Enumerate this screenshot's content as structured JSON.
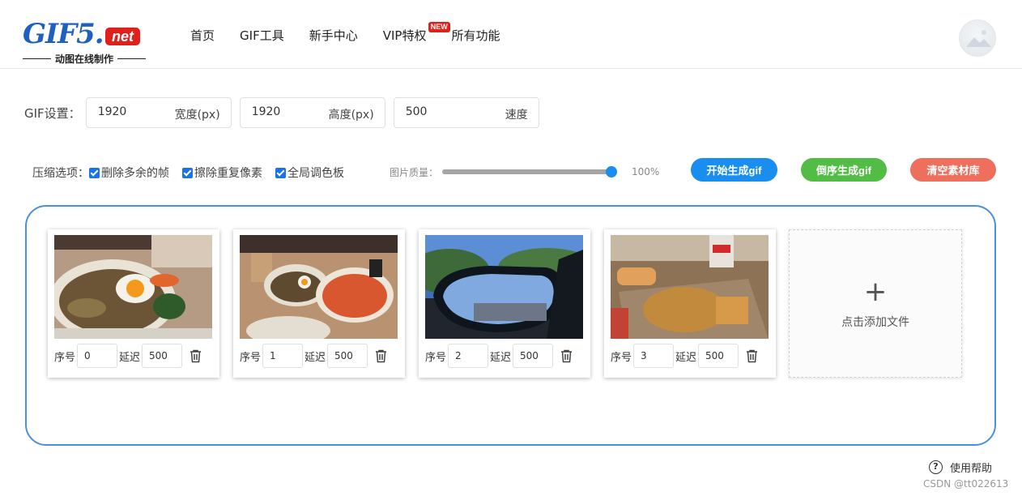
{
  "logo": {
    "main": "GIF5.",
    "net": "net",
    "subtitle": "动图在线制作"
  },
  "nav": [
    {
      "label": "首页"
    },
    {
      "label": "GIF工具"
    },
    {
      "label": "新手中心"
    },
    {
      "label": "VIP特权",
      "badge": "NEW"
    },
    {
      "label": "所有功能"
    }
  ],
  "settings": {
    "label": "GIF设置：",
    "width": {
      "value": "1920",
      "suffix": "宽度(px)"
    },
    "height": {
      "value": "1920",
      "suffix": "高度(px)"
    },
    "speed": {
      "value": "500",
      "suffix": "速度"
    }
  },
  "compress": {
    "label": "压缩选项：",
    "options": [
      {
        "label": "删除多余的帧",
        "checked": true
      },
      {
        "label": "擦除重复像素",
        "checked": true
      },
      {
        "label": "全局调色板",
        "checked": true
      }
    ]
  },
  "quality": {
    "label": "图片质量：",
    "value": 100,
    "display": "100%"
  },
  "buttons": {
    "start": "开始生成gif",
    "reverse": "倒序生成gif",
    "clear": "清空素材库"
  },
  "frame_labels": {
    "index": "序号",
    "delay": "延迟"
  },
  "frames": [
    {
      "index": "0",
      "delay": "500",
      "image": "food-bowl-egg"
    },
    {
      "index": "1",
      "delay": "500",
      "image": "food-table-pizza"
    },
    {
      "index": "2",
      "delay": "500",
      "image": "car-mirror-road"
    },
    {
      "index": "3",
      "delay": "500",
      "image": "food-waffle-chicken"
    }
  ],
  "add_file": {
    "label": "点击添加文件"
  },
  "help": {
    "label": "使用帮助"
  },
  "watermark": "CSDN @tt022613",
  "colors": {
    "primary": "#1a8ef0",
    "green": "#52bd45",
    "red": "#ef6f5d",
    "border": "#4b8fdf",
    "logo_blue": "#1f5fbf",
    "logo_red": "#e0201b"
  }
}
